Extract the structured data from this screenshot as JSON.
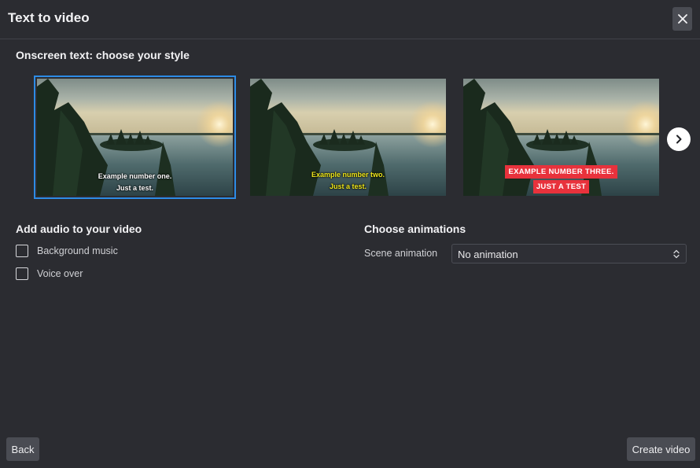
{
  "dialog": {
    "title": "Text to video",
    "close_icon": "close-icon"
  },
  "styles_section": {
    "title": "Onscreen text: choose your style",
    "styles": [
      {
        "line1": "Example number one.",
        "line2": "Just a test.",
        "text_color": "#ffffff",
        "selected": true
      },
      {
        "line1": "Example number two.",
        "line2": "Just a test.",
        "text_color": "#f0e81c",
        "selected": false
      },
      {
        "line1": "Example number three.",
        "line2": "Just a test",
        "text_color": "#ffffff",
        "highlight_color": "#e8323c",
        "selected": false
      }
    ],
    "next_icon": "chevron-right-icon"
  },
  "audio_section": {
    "title": "Add audio to your video",
    "options": [
      {
        "label": "Background music",
        "checked": false
      },
      {
        "label": "Voice over",
        "checked": false
      }
    ]
  },
  "animation_section": {
    "title": "Choose animations",
    "scene_label": "Scene animation",
    "scene_value": "No animation",
    "select_icon": "updown-chevron-icon"
  },
  "footer": {
    "back_label": "Back",
    "create_label": "Create video"
  },
  "colors": {
    "background": "#2b2c31",
    "selection_accent": "#2d8ce6",
    "button": "#4a4c53"
  }
}
